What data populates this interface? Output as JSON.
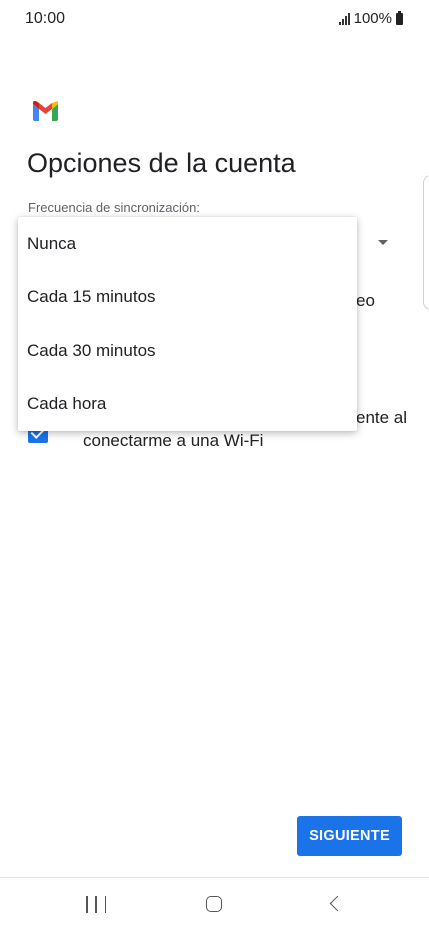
{
  "status_bar": {
    "time": "10:00",
    "battery": "100%"
  },
  "app": {
    "logo_icon": "gmail-icon",
    "title": "Opciones de la cuenta",
    "freq_label": "Frecuencia de sincronización:"
  },
  "behind": {
    "text_1": "eo",
    "text_2": "ente al",
    "wifi_label": "conectarme a una Wi-Fi"
  },
  "dropdown": {
    "options": [
      {
        "label": "Nunca"
      },
      {
        "label": "Cada 15 minutos"
      },
      {
        "label": "Cada 30 minutos"
      },
      {
        "label": "Cada hora"
      }
    ]
  },
  "next_button": {
    "label": "SIGUIENTE"
  },
  "colors": {
    "accent": "#1a73e8",
    "gmail_red": "#ea4335",
    "gmail_blue": "#4285f4",
    "gmail_green": "#34a853",
    "gmail_yellow": "#fbbc04"
  },
  "nav": {
    "recents_icon": "recents-icon",
    "home_icon": "home-icon",
    "back_icon": "back-icon"
  }
}
